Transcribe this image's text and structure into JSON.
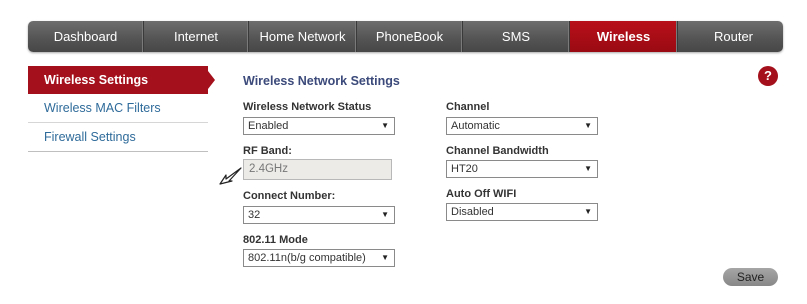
{
  "nav": {
    "tabs": [
      {
        "label": "Dashboard"
      },
      {
        "label": "Internet"
      },
      {
        "label": "Home Network"
      },
      {
        "label": "PhoneBook"
      },
      {
        "label": "SMS"
      },
      {
        "label": "Wireless"
      },
      {
        "label": "Router"
      }
    ],
    "active": "Wireless"
  },
  "sidebar": {
    "items": [
      {
        "label": "Wireless Settings"
      },
      {
        "label": "Wireless MAC Filters"
      },
      {
        "label": "Firewall Settings"
      }
    ],
    "active": "Wireless Settings"
  },
  "main": {
    "title": "Wireless Network Settings",
    "help_label": "?",
    "fields": {
      "network_status": {
        "label": "Wireless Network Status",
        "value": "Enabled"
      },
      "rf_band": {
        "label": "RF Band:",
        "value": "2.4GHz"
      },
      "connect_number": {
        "label": "Connect Number:",
        "value": "32"
      },
      "mode": {
        "label": "802.11 Mode",
        "value": "802.11n(b/g compatible)"
      },
      "channel": {
        "label": "Channel",
        "value": "Automatic"
      },
      "bandwidth": {
        "label": "Channel Bandwidth",
        "value": "HT20"
      },
      "auto_off": {
        "label": "Auto Off WIFI",
        "value": "Disabled"
      }
    },
    "save_label": "Save"
  },
  "colors": {
    "accent": "#a4101b",
    "nav_bg": "#555555",
    "link": "#2f6b9a"
  }
}
